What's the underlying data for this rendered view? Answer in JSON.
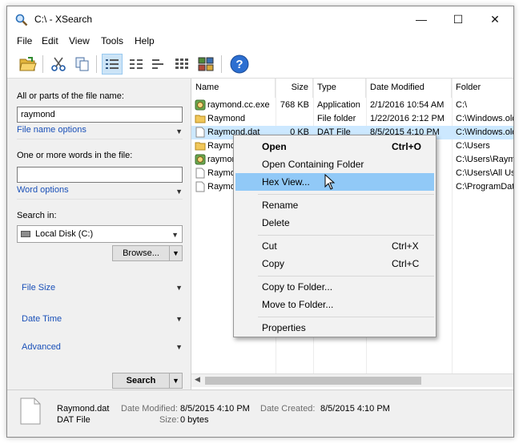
{
  "window": {
    "title": "C:\\ - XSearch",
    "controls": {
      "minimize": "—",
      "maximize": "☐",
      "close": "✕"
    }
  },
  "menu": [
    "File",
    "Edit",
    "View",
    "Tools",
    "Help"
  ],
  "toolbar": {
    "buttons": [
      "open-folder-icon",
      "scissors-icon",
      "copy-icon",
      "details-view-icon",
      "list-view-icon",
      "small-icons-view-icon",
      "tiles-view-icon",
      "thumbnails-view-icon",
      "help-icon"
    ],
    "active_button": "details-view-icon"
  },
  "search_panel": {
    "file_name_label": "All or parts of the file name:",
    "file_name_value": "raymond",
    "file_name_options": "File name options",
    "words_label": "One or more words in the file:",
    "words_value": "",
    "word_options": "Word options",
    "search_in_label": "Search in:",
    "search_in_value": "Local Disk (C:)",
    "browse_label": "Browse...",
    "sections": [
      "File Size",
      "Date Time",
      "Advanced"
    ],
    "search_button": "Search"
  },
  "results": {
    "columns": [
      "Name",
      "Size",
      "Type",
      "Date Modified",
      "Folder"
    ],
    "rows": [
      {
        "name": "raymond.cc.exe",
        "size": "768 KB",
        "type": "Application",
        "modified": "2/1/2016 10:54 AM",
        "folder": "C:\\",
        "icon": "exe-icon"
      },
      {
        "name": "Raymond",
        "size": "",
        "type": "File folder",
        "modified": "1/22/2016 2:12 PM",
        "folder": "C:\\Windows.old\\Use",
        "icon": "folder-icon"
      },
      {
        "name": "Raymond.dat",
        "size": "0 KB",
        "type": "DAT File",
        "modified": "8/5/2015 4:10 PM",
        "folder": "C:\\Windows.old\\Use",
        "icon": "document-icon",
        "selected": true
      },
      {
        "name": "Raymond",
        "size": "",
        "type": "",
        "modified": "",
        "folder": "C:\\Users",
        "icon": "folder-icon"
      },
      {
        "name": "raymond",
        "size": "",
        "type": "",
        "modified": "",
        "folder": "C:\\Users\\Raymond\\A",
        "icon": "exe-icon"
      },
      {
        "name": "Raymond",
        "size": "",
        "type": "",
        "modified": "",
        "folder": "C:\\Users\\All Users\\",
        "icon": "document-icon"
      },
      {
        "name": "Raymond",
        "size": "",
        "type": "",
        "modified": "",
        "folder": "C:\\ProgramData\\Mic",
        "icon": "document-icon"
      }
    ]
  },
  "context_menu": {
    "items": [
      {
        "label": "Open",
        "shortcut": "Ctrl+O",
        "bold": true
      },
      {
        "label": "Open Containing Folder",
        "shortcut": ""
      },
      {
        "label": "Hex View...",
        "shortcut": "",
        "highlighted": true
      },
      {
        "label": "Rename",
        "shortcut": ""
      },
      {
        "label": "Delete",
        "shortcut": ""
      },
      {
        "label": "Cut",
        "shortcut": "Ctrl+X"
      },
      {
        "label": "Copy",
        "shortcut": "Ctrl+C"
      },
      {
        "label": "Copy to Folder...",
        "shortcut": ""
      },
      {
        "label": "Move to Folder...",
        "shortcut": ""
      },
      {
        "label": "Properties",
        "shortcut": ""
      }
    ]
  },
  "status": {
    "file_name": "Raymond.dat",
    "file_type": "DAT File",
    "date_modified_label": "Date Modified:",
    "date_modified_value": "8/5/2015 4:10 PM",
    "size_label": "Size:",
    "size_value": "0 bytes",
    "date_created_label": "Date Created:",
    "date_created_value": "8/5/2015 4:10 PM"
  },
  "colors": {
    "accent_link": "#1a50b8",
    "selection": "#cce8ff",
    "menu_highlight": "#91c9f7"
  }
}
